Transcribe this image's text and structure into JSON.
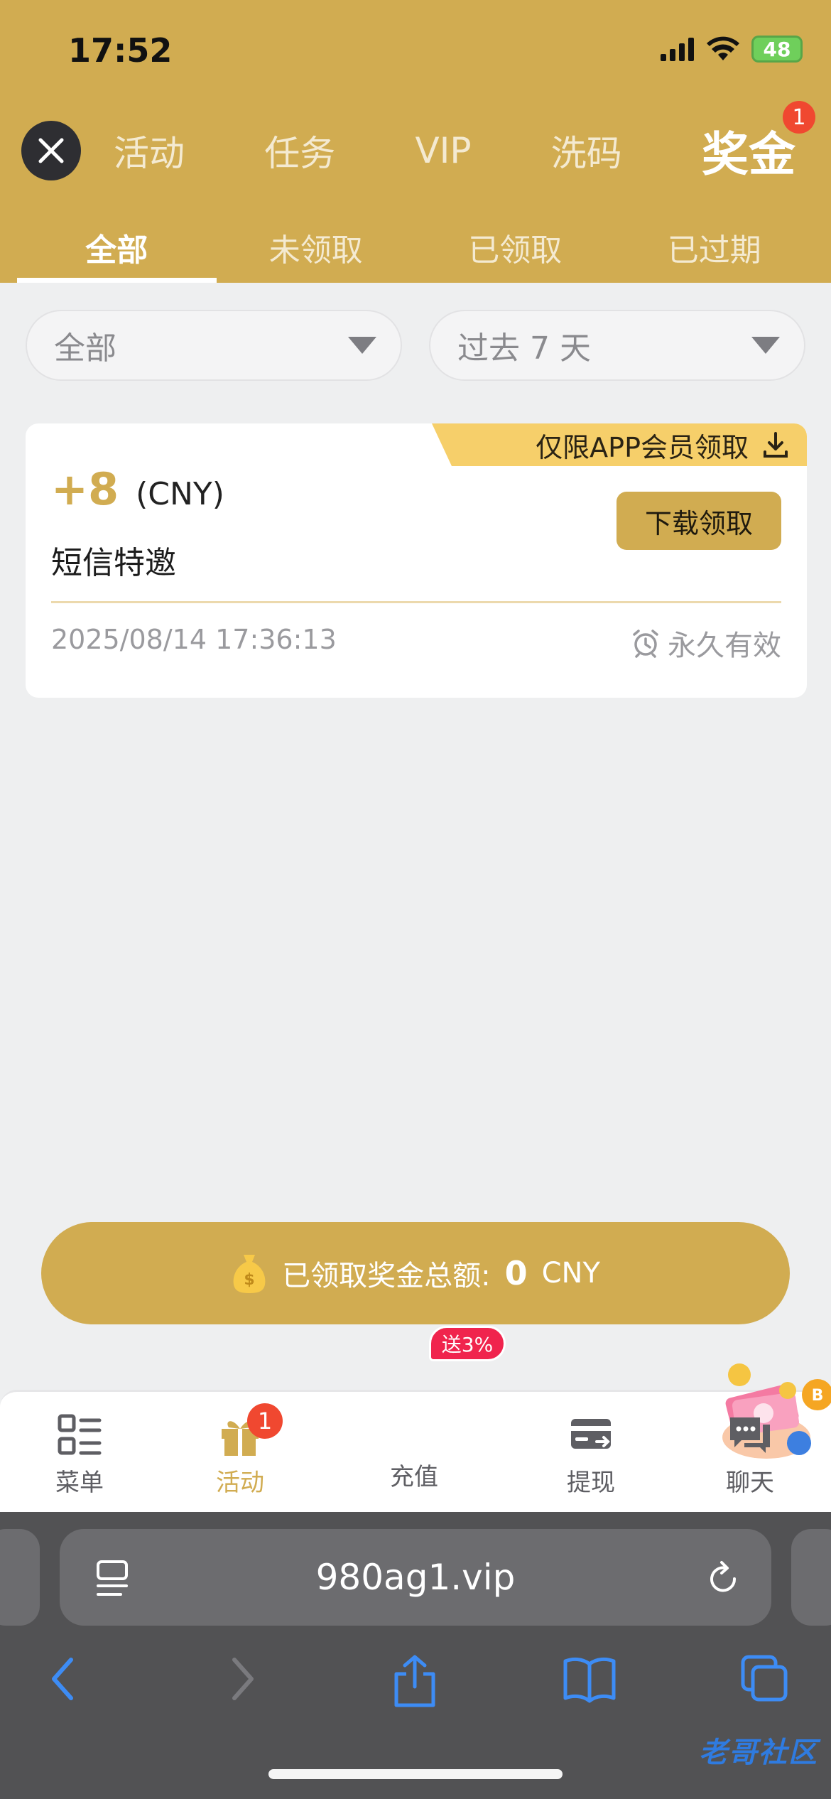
{
  "status_bar": {
    "time": "17:52",
    "battery": "48"
  },
  "nav": {
    "tabs": [
      "活动",
      "任务",
      "VIP",
      "洗码",
      "奖金"
    ],
    "active_tab": "奖金",
    "badge": "1"
  },
  "sub_tabs": [
    "全部",
    "未领取",
    "已领取",
    "已过期"
  ],
  "filters": {
    "type": "全部",
    "range": "过去 7 天"
  },
  "card": {
    "ribbon": "仅限APP会员领取",
    "amount": "+8",
    "currency": "(CNY)",
    "title": "短信特邀",
    "button": "下载领取",
    "time": "2025/08/14 17:36:13",
    "validity": "永久有效"
  },
  "total": {
    "label": "已领取奖金总额:",
    "value": "0",
    "unit": "CNY"
  },
  "bottom_nav": {
    "menu": "菜单",
    "activity": "活动",
    "activity_badge": "1",
    "recharge": "充值",
    "recharge_badge": "送3%",
    "withdraw": "提现",
    "chat": "聊天"
  },
  "browser": {
    "url": "980ag1.vip"
  },
  "colors": {
    "gold": "#d1ac51",
    "ribbon": "#f6cf6a",
    "badge_red": "#f04830"
  }
}
